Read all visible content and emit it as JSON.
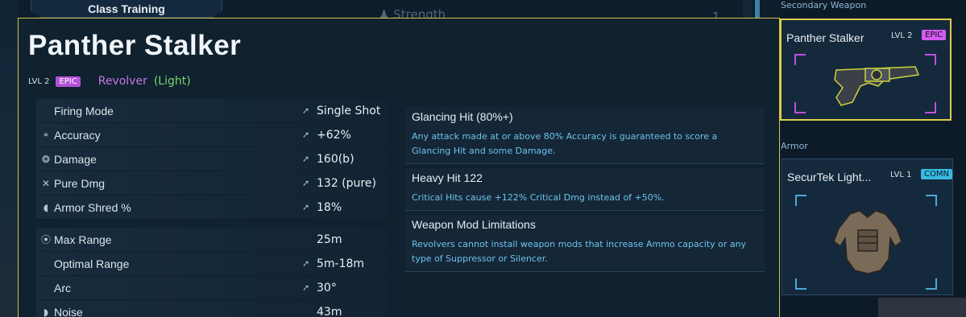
{
  "background": {
    "class_tab": "Class Training",
    "attribute_label": "Strength",
    "attribute_value": "1"
  },
  "tooltip": {
    "title": "Panther Stalker",
    "level": "LVL 2",
    "rarity": "EPIC",
    "weapon_type": "Revolver",
    "weight": "(Light)",
    "stats": [
      {
        "icon": "firing-mode-icon",
        "label": "Firing Mode",
        "value": "Single Shot",
        "arrow": true
      },
      {
        "icon": "accuracy-icon",
        "glyph": "⌖",
        "label": "Accuracy",
        "value": "+62%",
        "arrow": true
      },
      {
        "icon": "damage-icon",
        "glyph": "❂",
        "label": "Damage",
        "value": "160(b)",
        "arrow": true
      },
      {
        "icon": "pure-dmg-icon",
        "glyph": "✕",
        "label": "Pure Dmg",
        "value": "132 (pure)",
        "arrow": true
      },
      {
        "icon": "armor-shred-icon",
        "glyph": "◖",
        "label": "Armor Shred %",
        "value": "18%",
        "arrow": true
      },
      {
        "icon": "max-range-icon",
        "glyph": "⦿",
        "label": "Max Range",
        "value": "25m",
        "arrow": false
      },
      {
        "icon": "optimal-range-icon",
        "label": "Optimal Range",
        "value": "5m-18m",
        "arrow": true
      },
      {
        "icon": "arc-icon",
        "label": "Arc",
        "value": "30°",
        "arrow": true
      },
      {
        "icon": "noise-icon",
        "glyph": "◗",
        "label": "Noise",
        "value": "43m",
        "arrow": false
      }
    ],
    "perks": [
      {
        "title": "Glancing Hit (80%+)",
        "desc": "Any attack made at or above 80% Accuracy is guaranteed to score a Glancing Hit and some Damage."
      },
      {
        "title": "Heavy Hit 122",
        "desc": "Critical Hits cause +122% Critical Dmg instead of +50%."
      },
      {
        "title": "Weapon Mod Limitations",
        "desc": "Revolvers cannot install weapon mods that increase Ammo capacity or any type of Suppressor or Silencer."
      }
    ]
  },
  "equipment": {
    "secondary_label": "Secondary Weapon",
    "secondary": {
      "name": "Panther Stalker",
      "level": "LVL 2",
      "rarity": "EPIC"
    },
    "armor_label": "Armor",
    "armor": {
      "name": "SecurTek Light...",
      "level": "LVL 1",
      "rarity": "COMN"
    }
  },
  "colors": {
    "accent_border": "#d7c34a",
    "epic": "#b452d8",
    "common": "#39b8e2",
    "perk_desc": "#6cc4ec",
    "weight_light": "#77d86f"
  }
}
